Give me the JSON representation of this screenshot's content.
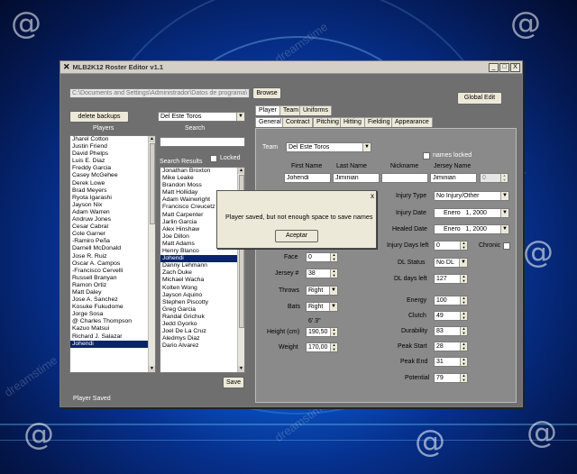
{
  "window": {
    "title": "MLB2K12 Roster Editor v1.1",
    "minimize": "_",
    "maximize": "□",
    "close": "X"
  },
  "toolbar": {
    "path": "C:\\Documents and Settings\\Administrador\\Datos de programa\\",
    "browse": "Browse",
    "global_edit": "Global Edit"
  },
  "left": {
    "delete_backups": "delete backups",
    "team_select": "Del Este Toros",
    "players_header": "Players",
    "search_header": "Search",
    "search_value": "",
    "locked_label": "Locked",
    "search_results_label": "Search Results",
    "players": [
      "Jharel Cotton",
      "Justin Friend",
      "David Phelps",
      "Luis E. Diaz",
      "Freddy Garcia",
      "Casey McGehee",
      "Derek Lowe",
      "Brad Meyers",
      "Ryota Igarashi",
      "Jayson Nix",
      "Adam Warren",
      "Andruw Jones",
      "Cesar Cabral",
      "Cole Garner",
      "-Ramiro Peña",
      "Darnell McDonald",
      "Jose R. Ruiz",
      "Oscar A. Campos",
      "-Francisco Cervelli",
      "Russell Branyan",
      "Ramon Ortiz",
      "Matt Daley",
      "Jose A. Sanchez",
      "Kosuke Fukudome",
      "Jorge Sosa",
      "@ Charles Thompson",
      "Kazuo Matsui",
      "Richard J. Salazar",
      "Johendi"
    ],
    "players_selected": 28,
    "results": [
      "Jonathan Broxton",
      "Mike Leake",
      "Brandon Moss",
      "Matt Holliday",
      "Adam Wainwright",
      "Francisco Creucetz",
      "Matt Carpenter",
      "Jarlin Garcia",
      "Alex Hinshaw",
      "Joe Dillon",
      "Matt Adams",
      "Henry Blanco",
      "Johendi",
      "Danny Lehmann",
      "Zach Duke",
      "Michael Wacha",
      "Kolten Wong",
      "Jayson Aquino",
      "Stephen Piscotty",
      "Greg Garcia",
      "Randal Grichuk",
      "Jedd Gyorko",
      "Joel De La Cruz",
      "Aledmys Diaz",
      "Dario Alvarez"
    ],
    "results_selected": 12,
    "save": "Save",
    "status": "Player Saved"
  },
  "tabs": {
    "top": [
      "Player",
      "Team",
      "Uniforms"
    ],
    "top_active": 0,
    "sub": [
      "General",
      "Contract",
      "Pitching",
      "Hitting",
      "Fielding",
      "Appearance"
    ],
    "sub_active": 0
  },
  "general": {
    "team_label": "Team",
    "team_value": "Del Este Toros",
    "names_locked": "names locked",
    "first_name_label": "First Name",
    "first_name": "Johendi",
    "last_name_label": "Last Name",
    "last_name": "Jiminian",
    "nickname_label": "Nickname",
    "nickname": "",
    "jersey_name_label": "Jersey Name",
    "jersey_name": "Jiminian",
    "jersey_extra": "0",
    "face_label": "Face",
    "face": "0",
    "jersey_num_label": "Jersey #",
    "jersey_num": "38",
    "throws_label": "Throws",
    "throws": "Right",
    "bats_label": "Bats",
    "bats": "Right",
    "height_ft": "6' 3\"",
    "height_label": "Height (cm)",
    "height": "190,50",
    "weight_label": "Weight",
    "weight": "170,00",
    "injury_type_label": "Injury Type",
    "injury_type": "No Injury/Other",
    "injury_date_label": "Injury Date",
    "injury_month": "Enero",
    "injury_day_year": "1, 2000",
    "healed_date_label": "Healed Date",
    "healed_month": "Enero",
    "healed_day_year": "1, 2000",
    "injury_days_label": "Injury Days left",
    "injury_days": "0",
    "chronic_label": "Chronic",
    "dl_status_label": "DL Status",
    "dl_status": "No DL",
    "dl_days_label": "DL days left",
    "dl_days": "127",
    "energy_label": "Energy",
    "energy": "100",
    "clutch_label": "Clutch",
    "clutch": "49",
    "durability_label": "Durability",
    "durability": "83",
    "peak_start_label": "Peak Start",
    "peak_start": "28",
    "peak_end_label": "Peak End",
    "peak_end": "31",
    "potential_label": "Potential",
    "potential": "79"
  },
  "dialog": {
    "message": "Player saved, but not enough space to save names",
    "ok": "Aceptar",
    "close": "x"
  }
}
